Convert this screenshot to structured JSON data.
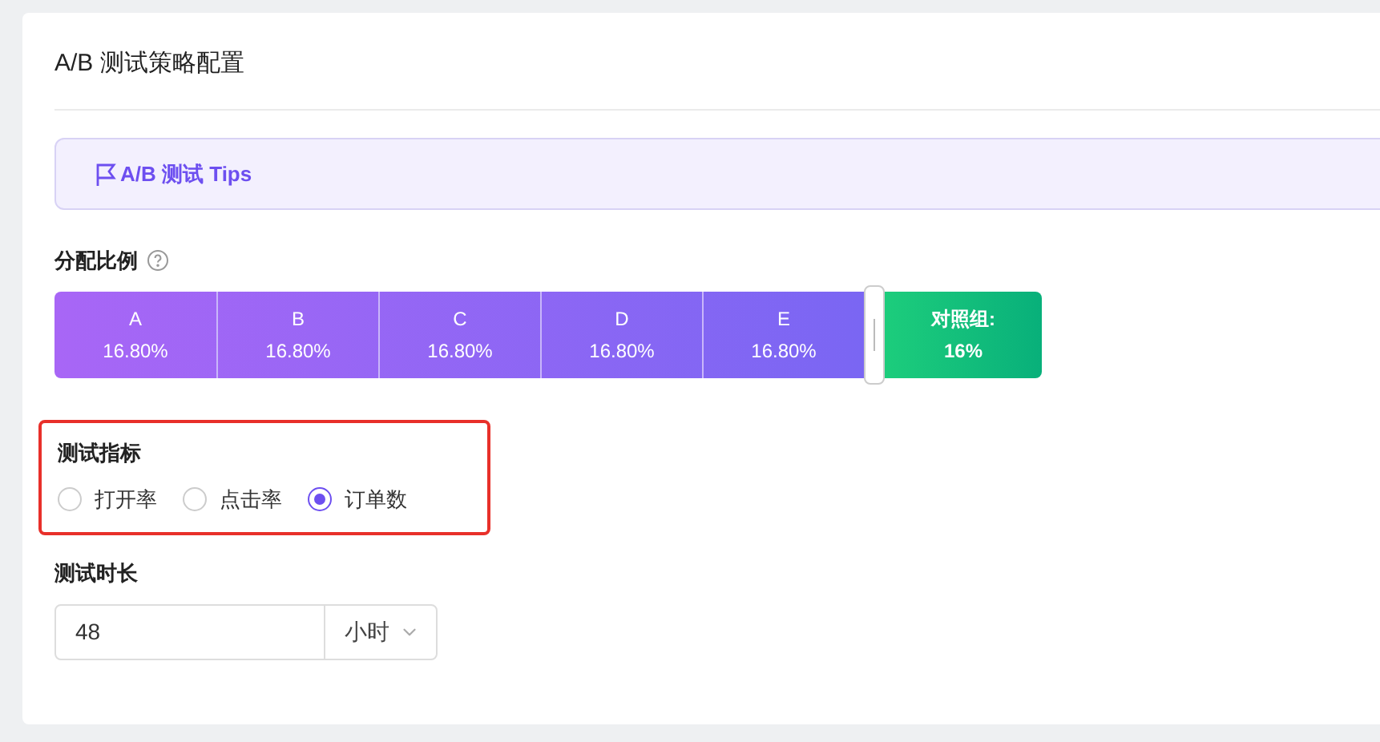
{
  "card": {
    "title": "A/B 测试策略配置"
  },
  "tips": {
    "text": "A/B 测试 Tips"
  },
  "split": {
    "label": "分配比例",
    "groups": [
      {
        "name": "A",
        "share": "16.80%"
      },
      {
        "name": "B",
        "share": "16.80%"
      },
      {
        "name": "C",
        "share": "16.80%"
      },
      {
        "name": "D",
        "share": "16.80%"
      },
      {
        "name": "E",
        "share": "16.80%"
      }
    ],
    "control": {
      "name": "对照组:",
      "share": "16%"
    }
  },
  "metric": {
    "label": "测试指标",
    "highlighted": true,
    "options": [
      {
        "label": "打开率",
        "selected": false
      },
      {
        "label": "点击率",
        "selected": false
      },
      {
        "label": "订单数",
        "selected": true
      }
    ]
  },
  "duration": {
    "label": "测试时长",
    "value": "48",
    "unit": "小时"
  }
}
